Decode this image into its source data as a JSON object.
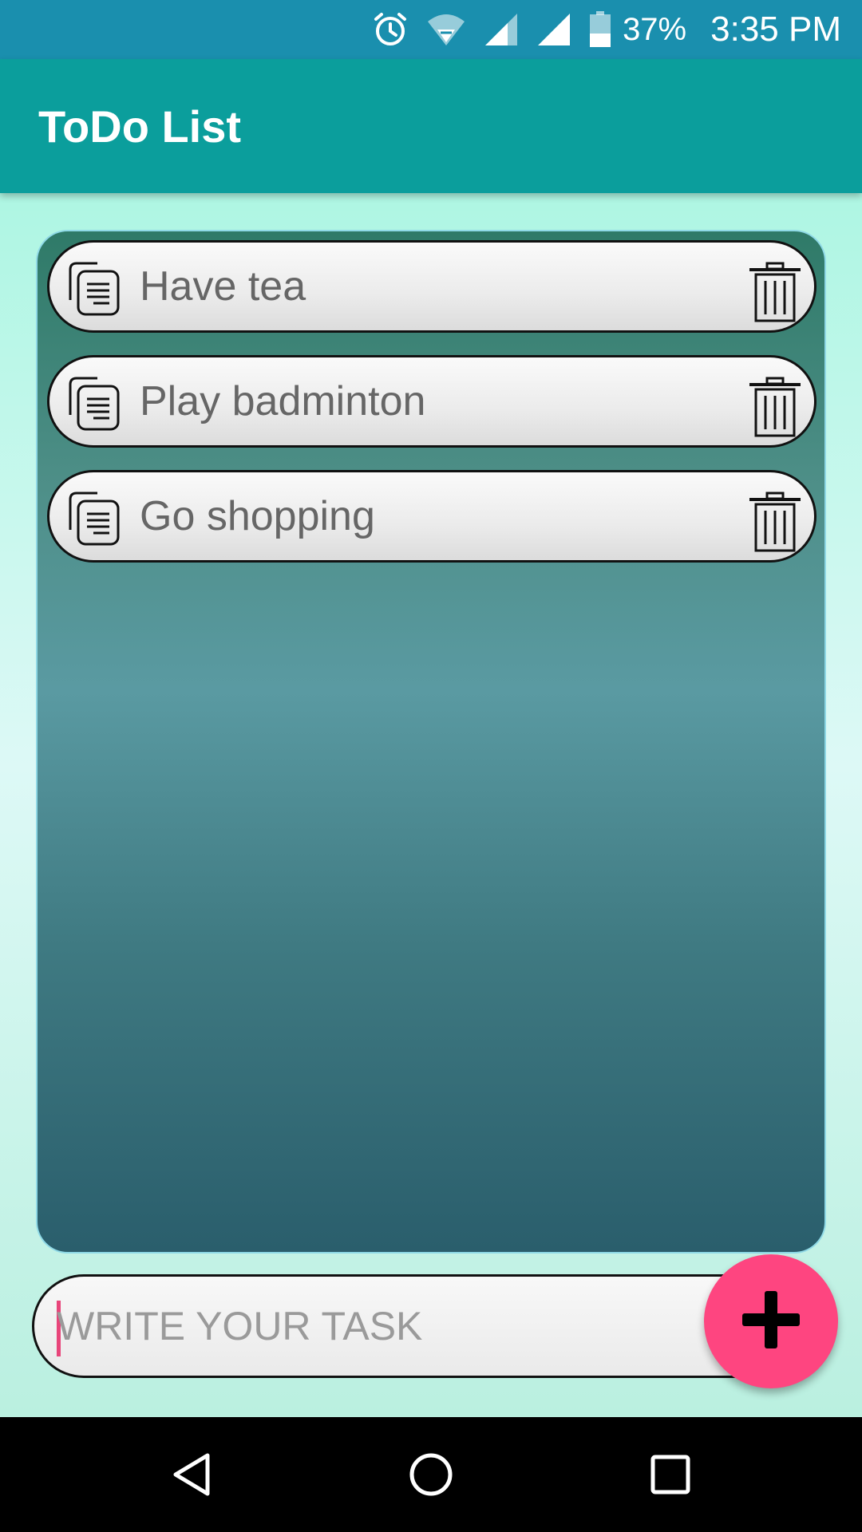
{
  "status_bar": {
    "battery": "37%",
    "time": "3:35 PM",
    "icons": [
      "alarm-icon",
      "wifi-icon",
      "signal-icon",
      "signal-icon",
      "battery-icon"
    ]
  },
  "app_bar": {
    "title": "ToDo List"
  },
  "tasks": [
    {
      "label": "Have tea"
    },
    {
      "label": "Play badminton"
    },
    {
      "label": "Go shopping"
    }
  ],
  "input": {
    "placeholder": "WRITE YOUR TASK",
    "value": ""
  },
  "fab": {
    "icon": "plus-icon",
    "color": "#fe4580"
  },
  "nav_bar": {
    "icons": [
      "back-icon",
      "home-icon",
      "recents-icon"
    ]
  },
  "colors": {
    "status_bar": "#1a8fae",
    "app_bar": "#0b9e9c",
    "accent": "#fe4580"
  }
}
